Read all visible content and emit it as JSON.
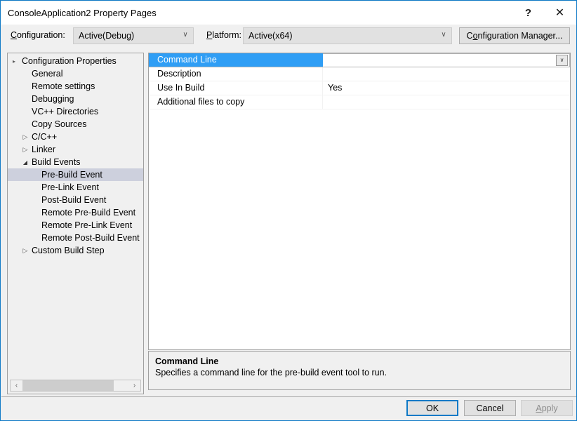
{
  "window": {
    "title": "ConsoleApplication2 Property Pages",
    "help_glyph": "?",
    "close_glyph": "✕"
  },
  "toolbar": {
    "configuration_label_pre": "",
    "configuration_label_accel": "C",
    "configuration_label_post": "onfiguration:",
    "configuration_value": "Active(Debug)",
    "platform_label_accel": "P",
    "platform_label_post": "latform:",
    "platform_value": "Active(x64)",
    "config_manager_pre": "C",
    "config_manager_accel": "o",
    "config_manager_post": "nfiguration Manager...",
    "dropdown_glyph": "∨"
  },
  "tree": {
    "items": [
      {
        "label": "Configuration Properties",
        "depth": 0,
        "expander": "expanded-root",
        "selected": false
      },
      {
        "label": "General",
        "depth": 1,
        "expander": "none",
        "selected": false
      },
      {
        "label": "Remote settings",
        "depth": 1,
        "expander": "none",
        "selected": false
      },
      {
        "label": "Debugging",
        "depth": 1,
        "expander": "none",
        "selected": false
      },
      {
        "label": "VC++ Directories",
        "depth": 1,
        "expander": "none",
        "selected": false
      },
      {
        "label": "Copy Sources",
        "depth": 1,
        "expander": "none",
        "selected": false
      },
      {
        "label": "C/C++",
        "depth": 1,
        "expander": "collapsed",
        "selected": false
      },
      {
        "label": "Linker",
        "depth": 1,
        "expander": "collapsed",
        "selected": false
      },
      {
        "label": "Build Events",
        "depth": 1,
        "expander": "expanded",
        "selected": false
      },
      {
        "label": "Pre-Build Event",
        "depth": 2,
        "expander": "none",
        "selected": true
      },
      {
        "label": "Pre-Link Event",
        "depth": 2,
        "expander": "none",
        "selected": false
      },
      {
        "label": "Post-Build Event",
        "depth": 2,
        "expander": "none",
        "selected": false
      },
      {
        "label": "Remote Pre-Build Event",
        "depth": 2,
        "expander": "none",
        "selected": false
      },
      {
        "label": "Remote Pre-Link Event",
        "depth": 2,
        "expander": "none",
        "selected": false
      },
      {
        "label": "Remote Post-Build Event",
        "depth": 2,
        "expander": "none",
        "selected": false
      },
      {
        "label": "Custom Build Step",
        "depth": 1,
        "expander": "collapsed",
        "selected": false
      }
    ],
    "scroll_left_glyph": "‹",
    "scroll_right_glyph": "›"
  },
  "grid": {
    "rows": [
      {
        "name": "Command Line",
        "value": "",
        "selected": true,
        "has_dropdown": true
      },
      {
        "name": "Description",
        "value": "",
        "selected": false,
        "has_dropdown": false
      },
      {
        "name": "Use In Build",
        "value": "Yes",
        "selected": false,
        "has_dropdown": false
      },
      {
        "name": "Additional files to copy",
        "value": "",
        "selected": false,
        "has_dropdown": false
      }
    ],
    "value_dropdown_glyph": "∨"
  },
  "description": {
    "title": "Command Line",
    "text": "Specifies a command line for the pre-build event tool to run."
  },
  "footer": {
    "ok_label": "OK",
    "cancel_label": "Cancel",
    "apply_accel": "A",
    "apply_post": "pply"
  },
  "colors": {
    "dialog_border": "#0f7ac7",
    "grid_selection": "#2f9ef5",
    "tree_selection": "#cdd0dd",
    "panel_background": "#f0f0f0",
    "control_face": "#e1e1e1"
  }
}
